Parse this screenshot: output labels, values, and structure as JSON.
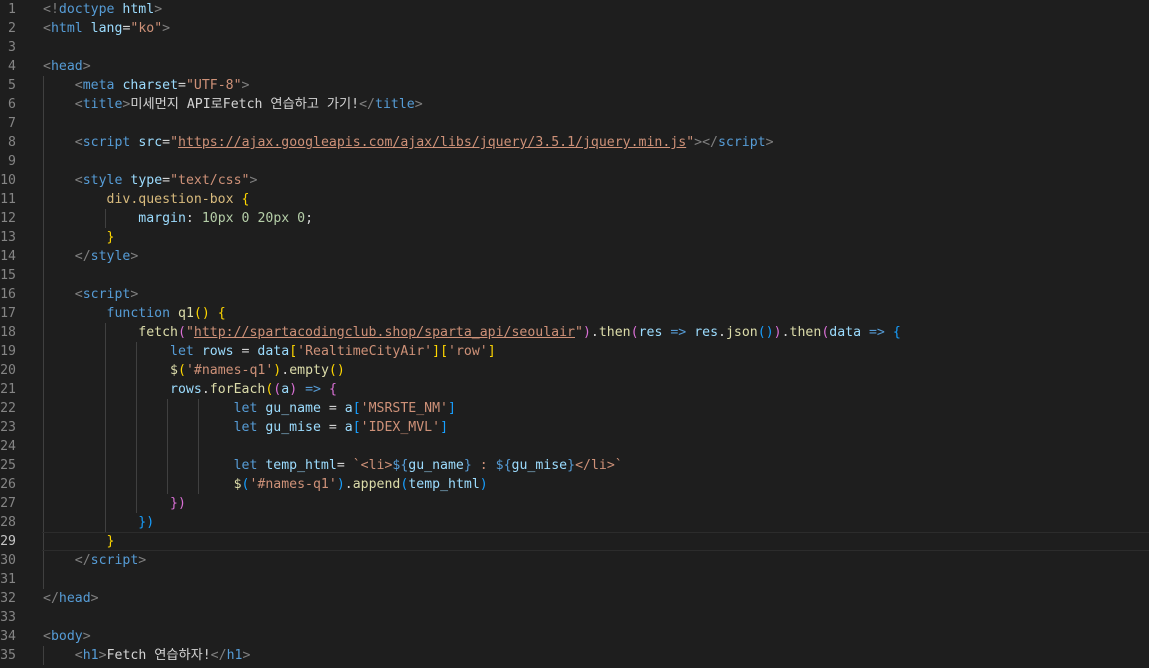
{
  "editor": {
    "current_line": 29,
    "lines": [
      {
        "n": 1,
        "tokens": [
          [
            "br",
            "<!"
          ],
          [
            "tag",
            "doctype"
          ],
          [
            "plain",
            " "
          ],
          [
            "attr",
            "html"
          ],
          [
            "br",
            ">"
          ]
        ]
      },
      {
        "n": 2,
        "tokens": [
          [
            "br",
            "<"
          ],
          [
            "tag",
            "html"
          ],
          [
            "plain",
            " "
          ],
          [
            "attr",
            "lang"
          ],
          [
            "plain",
            "="
          ],
          [
            "str",
            "\"ko\""
          ],
          [
            "br",
            ">"
          ]
        ]
      },
      {
        "n": 3,
        "tokens": []
      },
      {
        "n": 4,
        "tokens": [
          [
            "br",
            "<"
          ],
          [
            "tag",
            "head"
          ],
          [
            "br",
            ">"
          ]
        ]
      },
      {
        "n": 5,
        "tokens": [
          [
            "plain",
            "    "
          ],
          [
            "br",
            "<"
          ],
          [
            "tag",
            "meta"
          ],
          [
            "plain",
            " "
          ],
          [
            "attr",
            "charset"
          ],
          [
            "plain",
            "="
          ],
          [
            "str",
            "\"UTF-8\""
          ],
          [
            "br",
            ">"
          ]
        ]
      },
      {
        "n": 6,
        "tokens": [
          [
            "plain",
            "    "
          ],
          [
            "br",
            "<"
          ],
          [
            "tag",
            "title"
          ],
          [
            "br",
            ">"
          ],
          [
            "text",
            "미세먼지 API로Fetch 연습하고 가기!"
          ],
          [
            "br",
            "</"
          ],
          [
            "tag",
            "title"
          ],
          [
            "br",
            ">"
          ]
        ]
      },
      {
        "n": 7,
        "tokens": []
      },
      {
        "n": 8,
        "tokens": [
          [
            "plain",
            "    "
          ],
          [
            "br",
            "<"
          ],
          [
            "tag",
            "script"
          ],
          [
            "plain",
            " "
          ],
          [
            "attr",
            "src"
          ],
          [
            "plain",
            "="
          ],
          [
            "str",
            "\""
          ],
          [
            "str url",
            "https://ajax.googleapis.com/ajax/libs/jquery/3.5.1/jquery.min.js"
          ],
          [
            "str",
            "\""
          ],
          [
            "br",
            "></"
          ],
          [
            "tag",
            "script"
          ],
          [
            "br",
            ">"
          ]
        ]
      },
      {
        "n": 9,
        "tokens": []
      },
      {
        "n": 10,
        "tokens": [
          [
            "plain",
            "    "
          ],
          [
            "br",
            "<"
          ],
          [
            "tag",
            "style"
          ],
          [
            "plain",
            " "
          ],
          [
            "attr",
            "type"
          ],
          [
            "plain",
            "="
          ],
          [
            "str",
            "\"text/css\""
          ],
          [
            "br",
            ">"
          ]
        ]
      },
      {
        "n": 11,
        "tokens": [
          [
            "plain",
            "        "
          ],
          [
            "sel",
            "div.question-box"
          ],
          [
            "plain",
            " "
          ],
          [
            "b1",
            "{"
          ]
        ]
      },
      {
        "n": 12,
        "tokens": [
          [
            "plain",
            "            "
          ],
          [
            "prop",
            "margin"
          ],
          [
            "plain",
            ": "
          ],
          [
            "num",
            "10px"
          ],
          [
            "plain",
            " "
          ],
          [
            "num",
            "0"
          ],
          [
            "plain",
            " "
          ],
          [
            "num",
            "20px"
          ],
          [
            "plain",
            " "
          ],
          [
            "num",
            "0"
          ],
          [
            "plain",
            ";"
          ]
        ]
      },
      {
        "n": 13,
        "tokens": [
          [
            "plain",
            "        "
          ],
          [
            "b1",
            "}"
          ]
        ]
      },
      {
        "n": 14,
        "tokens": [
          [
            "plain",
            "    "
          ],
          [
            "br",
            "</"
          ],
          [
            "tag",
            "style"
          ],
          [
            "br",
            ">"
          ]
        ]
      },
      {
        "n": 15,
        "tokens": []
      },
      {
        "n": 16,
        "tokens": [
          [
            "plain",
            "    "
          ],
          [
            "br",
            "<"
          ],
          [
            "tag",
            "script"
          ],
          [
            "br",
            ">"
          ]
        ]
      },
      {
        "n": 17,
        "tokens": [
          [
            "plain",
            "        "
          ],
          [
            "kw",
            "function"
          ],
          [
            "plain",
            " "
          ],
          [
            "fn",
            "q1"
          ],
          [
            "b1",
            "()"
          ],
          [
            "plain",
            " "
          ],
          [
            "b1",
            "{"
          ]
        ]
      },
      {
        "n": 18,
        "tokens": [
          [
            "plain",
            "            "
          ],
          [
            "fn",
            "fetch"
          ],
          [
            "b2",
            "("
          ],
          [
            "str",
            "\""
          ],
          [
            "str url",
            "http://spartacodingclub.shop/sparta_api/seoulair"
          ],
          [
            "str",
            "\""
          ],
          [
            "b2",
            ")"
          ],
          [
            "plain",
            "."
          ],
          [
            "fn",
            "then"
          ],
          [
            "b2",
            "("
          ],
          [
            "var",
            "res"
          ],
          [
            "plain",
            " "
          ],
          [
            "kw",
            "=>"
          ],
          [
            "plain",
            " "
          ],
          [
            "var",
            "res"
          ],
          [
            "plain",
            "."
          ],
          [
            "fn",
            "json"
          ],
          [
            "b3",
            "()"
          ],
          [
            "b2",
            ")"
          ],
          [
            "plain",
            "."
          ],
          [
            "fn",
            "then"
          ],
          [
            "b2",
            "("
          ],
          [
            "var",
            "data"
          ],
          [
            "plain",
            " "
          ],
          [
            "kw",
            "=>"
          ],
          [
            "plain",
            " "
          ],
          [
            "b3",
            "{"
          ]
        ]
      },
      {
        "n": 19,
        "tokens": [
          [
            "plain",
            "                "
          ],
          [
            "kw",
            "let"
          ],
          [
            "plain",
            " "
          ],
          [
            "var",
            "rows"
          ],
          [
            "plain",
            " = "
          ],
          [
            "var",
            "data"
          ],
          [
            "b1",
            "["
          ],
          [
            "str",
            "'RealtimeCityAir'"
          ],
          [
            "b1",
            "]["
          ],
          [
            "str",
            "'row'"
          ],
          [
            "b1",
            "]"
          ]
        ]
      },
      {
        "n": 20,
        "tokens": [
          [
            "plain",
            "                "
          ],
          [
            "fn",
            "$"
          ],
          [
            "b1",
            "("
          ],
          [
            "str",
            "'#names-q1'"
          ],
          [
            "b1",
            ")"
          ],
          [
            "plain",
            "."
          ],
          [
            "fn",
            "empty"
          ],
          [
            "b1",
            "()"
          ]
        ]
      },
      {
        "n": 21,
        "tokens": [
          [
            "plain",
            "                "
          ],
          [
            "var",
            "rows"
          ],
          [
            "plain",
            "."
          ],
          [
            "fn",
            "forEach"
          ],
          [
            "b1",
            "("
          ],
          [
            "b2",
            "("
          ],
          [
            "var",
            "a"
          ],
          [
            "b2",
            ")"
          ],
          [
            "plain",
            " "
          ],
          [
            "kw",
            "=>"
          ],
          [
            "plain",
            " "
          ],
          [
            "b2",
            "{"
          ]
        ]
      },
      {
        "n": 22,
        "tokens": [
          [
            "plain",
            "                        "
          ],
          [
            "kw",
            "let"
          ],
          [
            "plain",
            " "
          ],
          [
            "var",
            "gu_name"
          ],
          [
            "plain",
            " = "
          ],
          [
            "var",
            "a"
          ],
          [
            "b3",
            "["
          ],
          [
            "str",
            "'MSRSTE_NM'"
          ],
          [
            "b3",
            "]"
          ]
        ]
      },
      {
        "n": 23,
        "tokens": [
          [
            "plain",
            "                        "
          ],
          [
            "kw",
            "let"
          ],
          [
            "plain",
            " "
          ],
          [
            "var",
            "gu_mise"
          ],
          [
            "plain",
            " = "
          ],
          [
            "var",
            "a"
          ],
          [
            "b3",
            "["
          ],
          [
            "str",
            "'IDEX_MVL'"
          ],
          [
            "b3",
            "]"
          ]
        ]
      },
      {
        "n": 24,
        "tokens": []
      },
      {
        "n": 25,
        "tokens": [
          [
            "plain",
            "                        "
          ],
          [
            "kw",
            "let"
          ],
          [
            "plain",
            " "
          ],
          [
            "var",
            "temp_html"
          ],
          [
            "plain",
            "= "
          ],
          [
            "str",
            "`<li>"
          ],
          [
            "kw",
            "${"
          ],
          [
            "var",
            "gu_name"
          ],
          [
            "kw",
            "}"
          ],
          [
            "str",
            " : "
          ],
          [
            "kw",
            "${"
          ],
          [
            "var",
            "gu_mise"
          ],
          [
            "kw",
            "}"
          ],
          [
            "str",
            "</li>`"
          ]
        ]
      },
      {
        "n": 26,
        "tokens": [
          [
            "plain",
            "                        "
          ],
          [
            "fn",
            "$"
          ],
          [
            "b3",
            "("
          ],
          [
            "str",
            "'#names-q1'"
          ],
          [
            "b3",
            ")"
          ],
          [
            "plain",
            "."
          ],
          [
            "fn",
            "append"
          ],
          [
            "b3",
            "("
          ],
          [
            "var",
            "temp_html"
          ],
          [
            "b3",
            ")"
          ]
        ]
      },
      {
        "n": 27,
        "tokens": [
          [
            "plain",
            "                "
          ],
          [
            "b2",
            "})"
          ]
        ]
      },
      {
        "n": 28,
        "tokens": [
          [
            "plain",
            "            "
          ],
          [
            "b3",
            "})"
          ]
        ]
      },
      {
        "n": 29,
        "tokens": [
          [
            "plain",
            "        "
          ],
          [
            "b1",
            "}"
          ]
        ]
      },
      {
        "n": 30,
        "tokens": [
          [
            "plain",
            "    "
          ],
          [
            "br",
            "</"
          ],
          [
            "tag",
            "script"
          ],
          [
            "br",
            ">"
          ]
        ]
      },
      {
        "n": 31,
        "tokens": []
      },
      {
        "n": 32,
        "tokens": [
          [
            "br",
            "</"
          ],
          [
            "tag",
            "head"
          ],
          [
            "br",
            ">"
          ]
        ]
      },
      {
        "n": 33,
        "tokens": []
      },
      {
        "n": 34,
        "tokens": [
          [
            "br",
            "<"
          ],
          [
            "tag",
            "body"
          ],
          [
            "br",
            ">"
          ]
        ]
      },
      {
        "n": 35,
        "tokens": [
          [
            "plain",
            "    "
          ],
          [
            "br",
            "<"
          ],
          [
            "tag",
            "h1"
          ],
          [
            "br",
            ">"
          ],
          [
            "text",
            "Fetch 연습하자!"
          ],
          [
            "br",
            "</"
          ],
          [
            "tag",
            "h1"
          ],
          [
            "br",
            ">"
          ]
        ]
      }
    ]
  }
}
